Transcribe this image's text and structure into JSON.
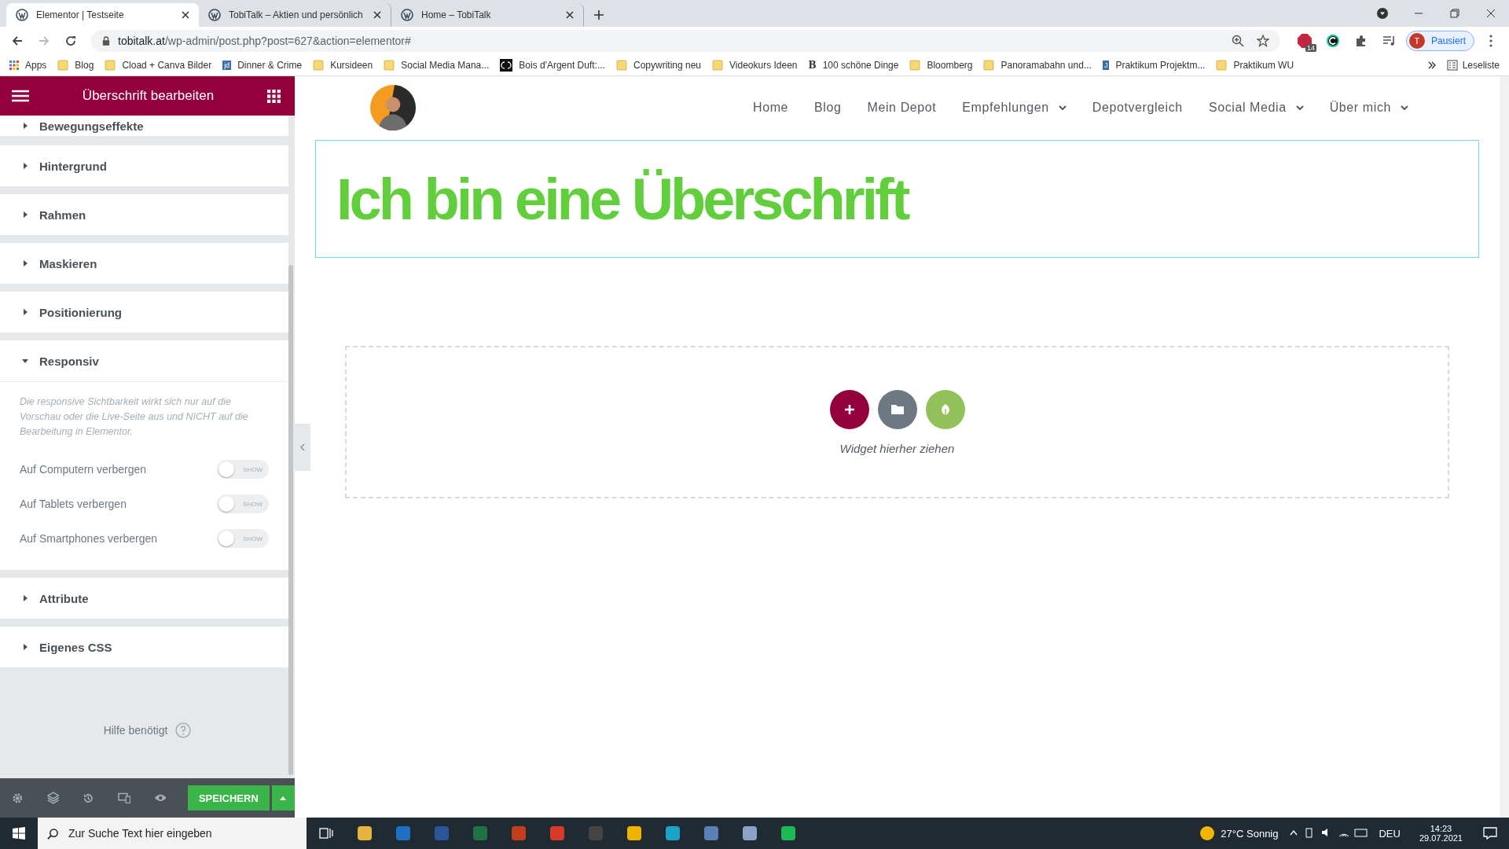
{
  "browser": {
    "tabs": [
      {
        "title": "Elementor | Testseite",
        "selected": true
      },
      {
        "title": "TobiTalk – Aktien und persönlich",
        "selected": false
      },
      {
        "title": "Home – TobiTalk",
        "selected": false
      }
    ],
    "url_host": "tobitalk.at",
    "url_path": "/wp-admin/post.php?post=627&action=elementor#",
    "extension_badge": "14",
    "profile_initial": "T",
    "profile_status": "Pausiert",
    "bookmarks": [
      {
        "label": "Apps",
        "kind": "apps"
      },
      {
        "label": "Blog",
        "kind": "folder"
      },
      {
        "label": "Cload + Canva Bilder",
        "kind": "folder"
      },
      {
        "label": "Dinner & Crime",
        "kind": "letter",
        "badge": "jd"
      },
      {
        "label": "Kursideen",
        "kind": "folder"
      },
      {
        "label": "Social Media Mana...",
        "kind": "folder"
      },
      {
        "label": "Bois d'Argent Duft:...",
        "kind": "logo"
      },
      {
        "label": "Copywriting neu",
        "kind": "folder"
      },
      {
        "label": "Videokurs Ideen",
        "kind": "folder"
      },
      {
        "label": "100 schöne Dinge",
        "kind": "bold",
        "badge": "B"
      },
      {
        "label": "Bloomberg",
        "kind": "folder"
      },
      {
        "label": "Panoramabahn und...",
        "kind": "folder"
      },
      {
        "label": "Praktikum Projektm...",
        "kind": "letter",
        "badge": "J"
      },
      {
        "label": "Praktikum WU",
        "kind": "folder"
      }
    ],
    "reading_list": "Leseliste"
  },
  "panel": {
    "title": "Überschrift bearbeiten",
    "sections": [
      {
        "title": "Bewegungseffekte",
        "expanded": false
      },
      {
        "title": "Hintergrund",
        "expanded": false
      },
      {
        "title": "Rahmen",
        "expanded": false
      },
      {
        "title": "Maskieren",
        "expanded": false
      },
      {
        "title": "Positionierung",
        "expanded": false
      },
      {
        "title": "Responsiv",
        "expanded": true,
        "description": "Die responsive Sichtbarkeit wirkt sich nur auf die Vorschau oder die Live-Seite aus und NICHT auf die Bearbeitung in Elementor.",
        "toggles": [
          {
            "label": "Auf Computern verbergen",
            "on": false,
            "state_text": "SHOW"
          },
          {
            "label": "Auf Tablets verbergen",
            "on": false,
            "state_text": "SHOW"
          },
          {
            "label": "Auf Smartphones verbergen",
            "on": false,
            "state_text": "SHOW"
          }
        ]
      },
      {
        "title": "Attribute",
        "expanded": false
      },
      {
        "title": "Eigenes CSS",
        "expanded": false
      }
    ],
    "help": "Hilfe benötigt",
    "save": "SPEICHERN"
  },
  "page": {
    "nav": [
      {
        "label": "Home",
        "dropdown": false
      },
      {
        "label": "Blog",
        "dropdown": false
      },
      {
        "label": "Mein Depot",
        "dropdown": false
      },
      {
        "label": "Empfehlungen",
        "dropdown": true
      },
      {
        "label": "Depotvergleich",
        "dropdown": false
      },
      {
        "label": "Social Media",
        "dropdown": true
      },
      {
        "label": "Über mich",
        "dropdown": true
      }
    ],
    "heading": "Ich bin eine Überschrift",
    "heading_selected": true,
    "drop_hint": "Widget hierher ziehen"
  },
  "taskbar": {
    "search_placeholder": "Zur Suche Text hier eingeben",
    "weather": "27°C Sonnig",
    "language": "DEU",
    "time": "14:23",
    "date": "29.07.2021"
  }
}
